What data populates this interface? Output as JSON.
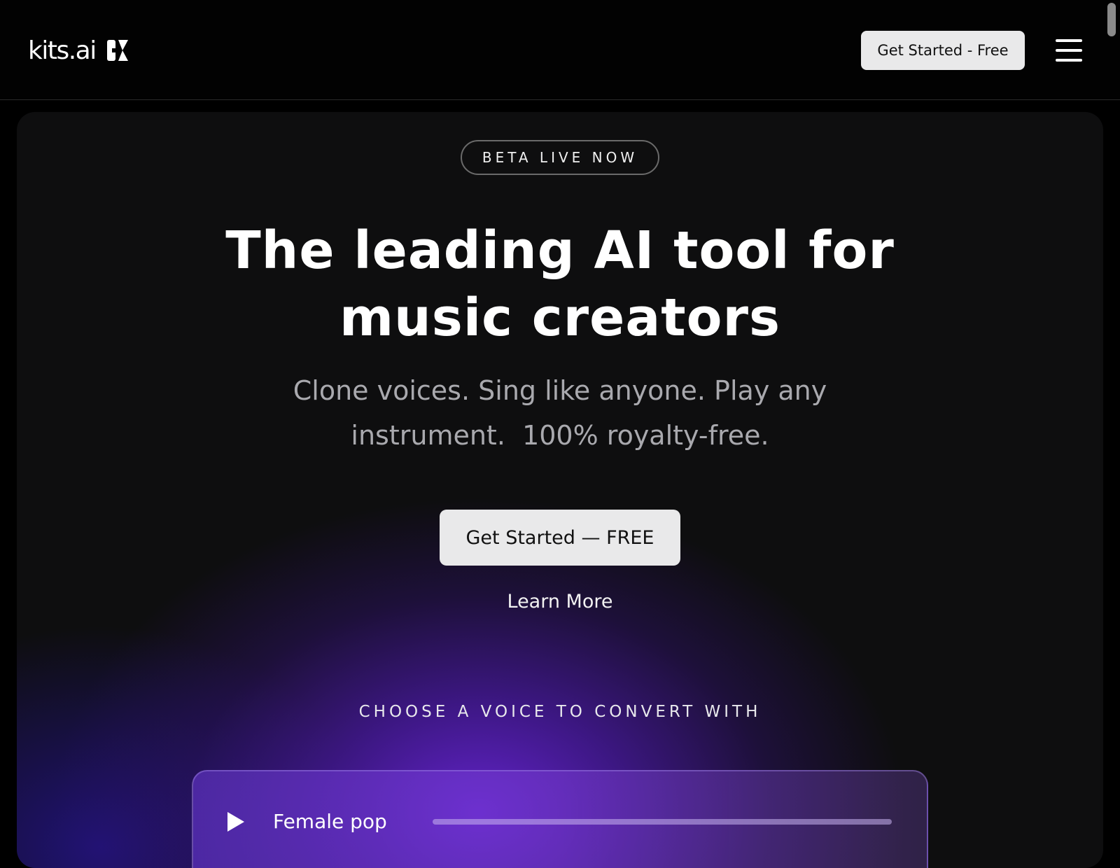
{
  "header": {
    "logo_text": "kits.ai",
    "cta_label": "Get Started - Free"
  },
  "hero": {
    "badge": "BETA LIVE NOW",
    "title_line1": "The leading AI tool for",
    "title_line2": "music creators",
    "subtitle_line1": "Clone voices. Sing like anyone. Play any",
    "subtitle_line2": "instrument.  100% royalty-free.",
    "cta_label": "Get Started — FREE",
    "learn_more_label": "Learn More"
  },
  "voice_picker": {
    "heading": "CHOOSE A VOICE TO CONVERT WITH",
    "selected_voice": "Female pop",
    "progress": 0
  },
  "icons": {
    "logo_mark": "kits-logo-icon",
    "menu": "hamburger-menu-icon",
    "play": "play-icon"
  },
  "colors": {
    "accent_purple": "#6624d2",
    "button_bg": "#e9e9ea",
    "page_bg": "#000000"
  }
}
